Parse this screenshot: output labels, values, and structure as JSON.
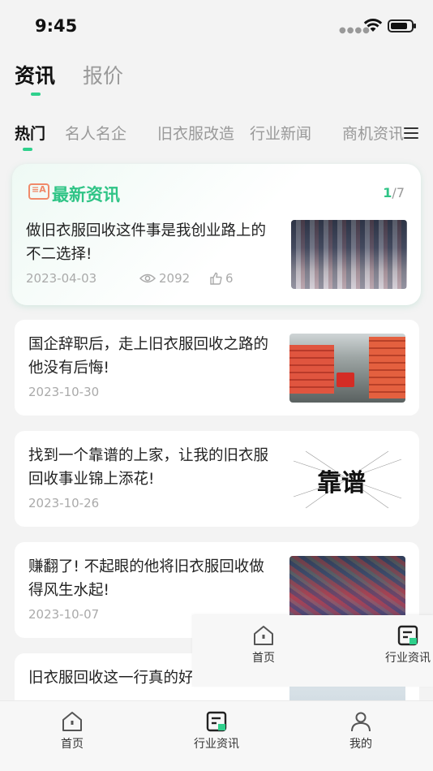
{
  "status_bar": {
    "time": "9:45"
  },
  "main_tabs": [
    {
      "label": "资讯",
      "active": true
    },
    {
      "label": "报价",
      "active": false
    }
  ],
  "sub_tabs": [
    {
      "label": "热门",
      "active": true
    },
    {
      "label": "名人名企",
      "active": false
    },
    {
      "label": "旧衣服改造",
      "active": false
    },
    {
      "label": "行业新闻",
      "active": false
    },
    {
      "label": "商机资讯",
      "active": false
    }
  ],
  "featured": {
    "title": "最新资讯",
    "pager_current": "1",
    "pager_total": "/7",
    "headline": "做旧衣服回收这件事是我创业路上的不二选择!",
    "date": "2023-04-03",
    "views": "2092",
    "likes": "6"
  },
  "news_list": [
    {
      "title": "国企辞职后，走上旧衣服回收之路的他没有后悔!",
      "date": "2023-10-30"
    },
    {
      "title": "找到一个靠谱的上家，让我的旧衣服回收事业锦上添花!",
      "date": "2023-10-26",
      "thumb_text": "靠谱"
    },
    {
      "title": "赚翻了! 不起眼的他将旧衣服回收做得风生水起!",
      "date": "2023-10-07"
    },
    {
      "title": "旧衣服回收这一行真的好做吗?",
      "date": ""
    }
  ],
  "overlay_tabbar": [
    {
      "label": "首页",
      "icon": "home-icon"
    },
    {
      "label": "行业资讯",
      "icon": "news-icon"
    }
  ],
  "bottom_tabbar": [
    {
      "label": "首页",
      "icon": "home-icon"
    },
    {
      "label": "行业资讯",
      "icon": "news-icon"
    },
    {
      "label": "我的",
      "icon": "user-icon"
    }
  ],
  "colors": {
    "accent": "#2fd08c",
    "accent_text": "#2fc486",
    "muted": "#999999"
  }
}
